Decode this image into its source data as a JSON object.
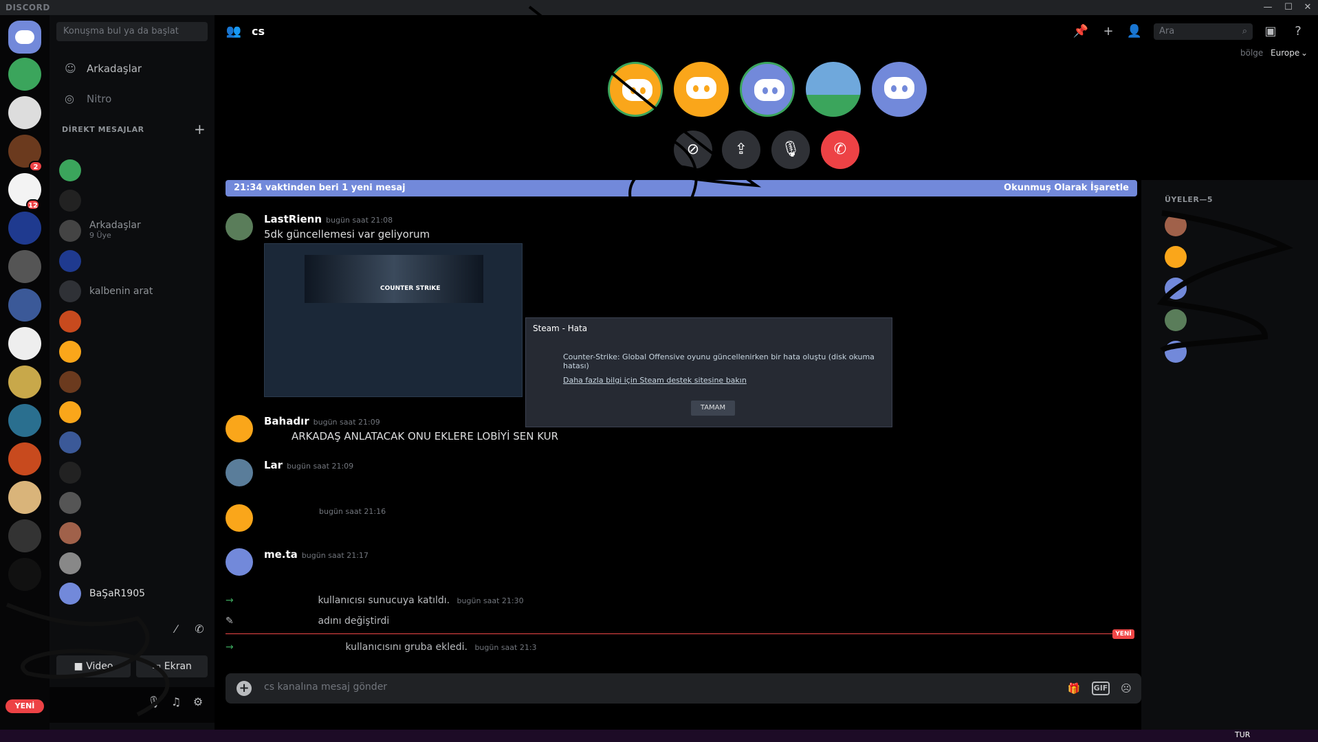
{
  "titlebar": {
    "app_name": "DISCORD",
    "minimize": "—",
    "maximize": "☐",
    "close": "✕"
  },
  "channels": {
    "search_placeholder": "Konuşma bul ya da başlat",
    "friends_label": "Arkadaşlar",
    "nitro_label": "Nitro",
    "dm_header": "DİREKT MESAJLAR",
    "dm_add": "+",
    "visible_dm_name": "BaŞaR1905",
    "dm_partial_1": "Arkadaşlar",
    "dm_partial_2": "9 Üye",
    "dm_partial_3": "kalbenin arat"
  },
  "voice": {
    "video_label": "Video",
    "screen_label": "Ekran"
  },
  "user_panel": {
    "new_label": "YENİ"
  },
  "header": {
    "channel_name": "cs",
    "search_placeholder": "Ara",
    "region_label": "bölge",
    "region_value": "Europe"
  },
  "new_messages": {
    "text": "21:34 vaktinden beri 1 yeni mesaj",
    "mark_read": "Okunmuş Olarak İşaretle"
  },
  "messages": [
    {
      "author": "LastRienn",
      "timestamp": "bugün saat 21:08",
      "text": "5dk güncellemesi var geliyorum"
    },
    {
      "author": "Bahadır",
      "timestamp": "bugün saat 21:09",
      "text": "ARKADAŞ ANLATACAK ONU EKLERE LOBİYİ SEN KUR"
    },
    {
      "author": "Lar",
      "timestamp": "bugün saat 21:09",
      "text": ""
    },
    {
      "author": "",
      "timestamp": "bugün saat 21:16",
      "text": ""
    },
    {
      "author": "me.ta",
      "timestamp": "bugün saat 21:17",
      "text": ""
    }
  ],
  "system_messages": [
    {
      "text": "kullanıcısı sunucuya katıldı.",
      "timestamp": "bugün saat 21:30"
    },
    {
      "text": "adını değiştirdi",
      "timestamp": ""
    },
    {
      "text": "kullanıcısını gruba ekledi.",
      "timestamp": "bugün saat 21:3"
    }
  ],
  "new_tag": "YENİ",
  "screenshot_logo": "COUNTER STRIKE",
  "steam_dialog": {
    "title": "Steam - Hata",
    "message": "Counter-Strike: Global Offensive oyunu güncellenirken bir hata oluştu (disk okuma hatası)",
    "link": "Daha fazla bilgi için Steam destek sitesine bakın",
    "ok": "TAMAM"
  },
  "composer": {
    "placeholder": "cs kanalına mesaj gönder",
    "gif": "GIF"
  },
  "members": {
    "header": "ÜYELER—5"
  },
  "taskbar": {
    "lang": "TUR"
  },
  "colors": {
    "blurple": "#7289da",
    "danger": "#ed4245",
    "online": "#3ba55c",
    "amber": "#faa61a"
  }
}
